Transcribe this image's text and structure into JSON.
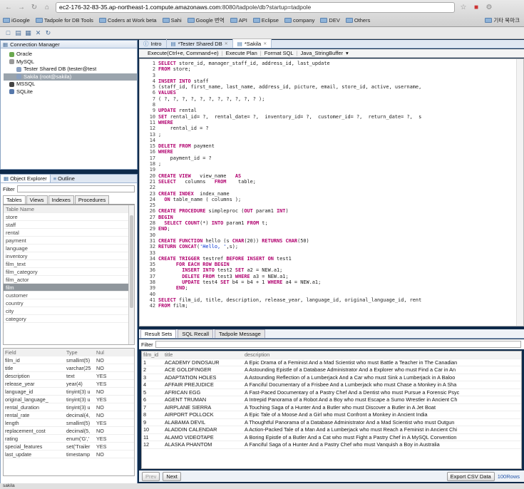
{
  "browser": {
    "url_prefix": "ec2-176-32-83-35.ap-northeast-1.compute.amazonaws.com",
    "url_suffix": ":8080/tadpole/db?startup=tadpole",
    "bookmarks": [
      "iGoogle",
      "Tadpole for DB Tools",
      "Coders at Work beta",
      "Sahi",
      "Google 번역",
      "API",
      "Eclipse",
      "company",
      "DEV",
      "Others"
    ],
    "other_bookmarks": "기타 북마크"
  },
  "connection_manager": {
    "title": "Connection Manager",
    "tree": [
      {
        "label": "Oracle",
        "level": 1,
        "color": "#6aa84f"
      },
      {
        "label": "MySQL",
        "level": 1,
        "color": "#999999"
      },
      {
        "label": "Tester Shared DB (tester@test",
        "level": 2,
        "color": "#8aa0c0"
      },
      {
        "label": "Sakila (root@sakila)",
        "level": 2,
        "color": "#8aa0c0",
        "selected": true
      },
      {
        "label": "MSSQL",
        "level": 1,
        "color": "#444444"
      },
      {
        "label": "SQLite",
        "level": 1,
        "color": "#5577aa"
      }
    ]
  },
  "object_explorer": {
    "tab_object": "Object Explorer",
    "tab_outline": "Outline",
    "filter_label": "Filter",
    "subtabs": [
      "Tables",
      "Views",
      "Indexes",
      "Procedures"
    ],
    "table_header": "Table Name",
    "tables": [
      "store",
      "staff",
      "rental",
      "payment",
      "language",
      "inventory",
      "film_text",
      "film_category",
      "film_actor",
      "film",
      "customer",
      "country",
      "city",
      "category"
    ],
    "selected_table": "film",
    "field_headers": [
      "Field",
      "Type",
      "Nul"
    ],
    "fields": [
      [
        "film_id",
        "smallint(5)",
        "NO"
      ],
      [
        "title",
        "varchar(25",
        "NO"
      ],
      [
        "description",
        "text",
        "YES"
      ],
      [
        "release_year",
        "year(4)",
        "YES"
      ],
      [
        "language_id",
        "tinyint(3) u",
        "NO"
      ],
      [
        "original_language_",
        "tinyint(3) u",
        "YES"
      ],
      [
        "rental_duration",
        "tinyint(3) u",
        "NO"
      ],
      [
        "rental_rate",
        "decimal(4,",
        "NO"
      ],
      [
        "length",
        "smallint(5)",
        "YES"
      ],
      [
        "replacement_cost",
        "decimal(5,",
        "NO"
      ],
      [
        "rating",
        "enum('G','",
        "YES"
      ],
      [
        "special_features",
        "set('Trailer",
        "YES"
      ],
      [
        "last_update",
        "timestamp",
        "NO"
      ]
    ]
  },
  "editor": {
    "tabs": [
      "Intro",
      "*Tester Shared DB",
      "*Sakila"
    ],
    "toolbar": [
      "Execute(Ctrl+e, Command+e)",
      "Execute Plan",
      "Format SQL",
      "Java_StringBuffer"
    ],
    "lines": [
      "SELECT store_id, manager_staff_id, address_id, last_update",
      "FROM store;",
      "",
      "INSERT INTO staff",
      "(staff_id, first_name, last_name, address_id, picture, email, store_id, active, username,",
      "VALUES",
      "( ?, ?, ?, ?, ?, ?, ?, ?, ?, ?, ? );",
      "",
      "UPDATE rental",
      "SET rental_id= ?,  rental_date= ?,  inventory_id= ?,  customer_id= ?,  return_date= ?,  s",
      "WHERE",
      "    rental_id = ?",
      ";",
      "",
      "DELETE FROM payment",
      "WHERE",
      "    payment_id = ?",
      ";",
      "",
      "CREATE VIEW   view_name   AS",
      "SELECT   columns   FROM    table;",
      "",
      "CREATE INDEX  index_name",
      "  ON table_name ( columns );",
      "",
      "CREATE PROCEDURE simpleproc (OUT param1 INT)",
      "BEGIN",
      "  SELECT COUNT(*) INTO param1 FROM t;",
      "END;",
      "",
      "CREATE FUNCTION hello (s CHAR(20)) RETURNS CHAR(50)",
      "RETURN CONCAT('Hello, ',s);",
      "",
      "CREATE TRIGGER testref BEFORE INSERT ON test1",
      "      FOR EACH ROW BEGIN",
      "        INSERT INTO test2 SET a2 = NEW.a1;",
      "        DELETE FROM test3 WHERE a3 = NEW.a1;",
      "        UPDATE test4 SET b4 = b4 + 1 WHERE a4 = NEW.a1;",
      "      END;",
      "",
      "SELECT film_id, title, description, release_year, language_id, original_language_id, rent",
      "FROM film;"
    ]
  },
  "results": {
    "tabs": [
      "Result Sets",
      "SQL Recall",
      "Tadpole Message"
    ],
    "filter_label": "Filter",
    "headers": [
      "film_id",
      "title",
      "description"
    ],
    "rows": [
      [
        "1",
        "ACADEMY DINOSAUR",
        "A Epic Drama of a Feminist And a Mad Scientist who must Battle a Teacher in The Canadian"
      ],
      [
        "2",
        "ACE GOLDFINGER",
        "A Astounding Epistle of a Database Administrator And a Explorer who must Find a Car in An"
      ],
      [
        "3",
        "ADAPTATION HOLES",
        "A Astounding Reflection of a Lumberjack And a Car who must Sink a Lumberjack in A Baloo"
      ],
      [
        "4",
        "AFFAIR PREJUDICE",
        "A Fanciful Documentary of a Frisbee And a Lumberjack who must Chase a Monkey in A Sha"
      ],
      [
        "5",
        "AFRICAN EGG",
        "A Fast-Paced Documentary of a Pastry Chef And a Dentist who must Pursue a Forensic Psyc"
      ],
      [
        "6",
        "AGENT TRUMAN",
        "A Intrepid Panorama of a Robot And a Boy who must Escape a Sumo Wrestler in Ancient Ch"
      ],
      [
        "7",
        "AIRPLANE SIERRA",
        "A Touching Saga of a Hunter And a Butler who must Discover a Butler in A Jet Boat"
      ],
      [
        "8",
        "AIRPORT POLLOCK",
        "A Epic Tale of a Moose And a Girl who must Confront a Monkey in Ancient India"
      ],
      [
        "9",
        "ALABAMA DEVIL",
        "A Thoughtful Panorama of a Database Administrator And a Mad Scientist who must Outgun"
      ],
      [
        "10",
        "ALADDIN CALENDAR",
        "A Action-Packed Tale of a Man And a Lumberjack who must Reach a Feminist in Ancient Chi"
      ],
      [
        "11",
        "ALAMO VIDEOTAPE",
        "A Boring Epistle of a Butler And a Cat who must Fight a Pastry Chef in A MySQL Convention"
      ],
      [
        "12",
        "ALASKA PHANTOM",
        "A Fanciful Saga of a Hunter And a Pastry Chef who must Vanquish a Boy in Australia"
      ]
    ],
    "prev_label": "Prev",
    "next_label": "Next",
    "export_label": "Export CSV Data",
    "rows_label": "100Rows"
  },
  "status_text": "sakila"
}
